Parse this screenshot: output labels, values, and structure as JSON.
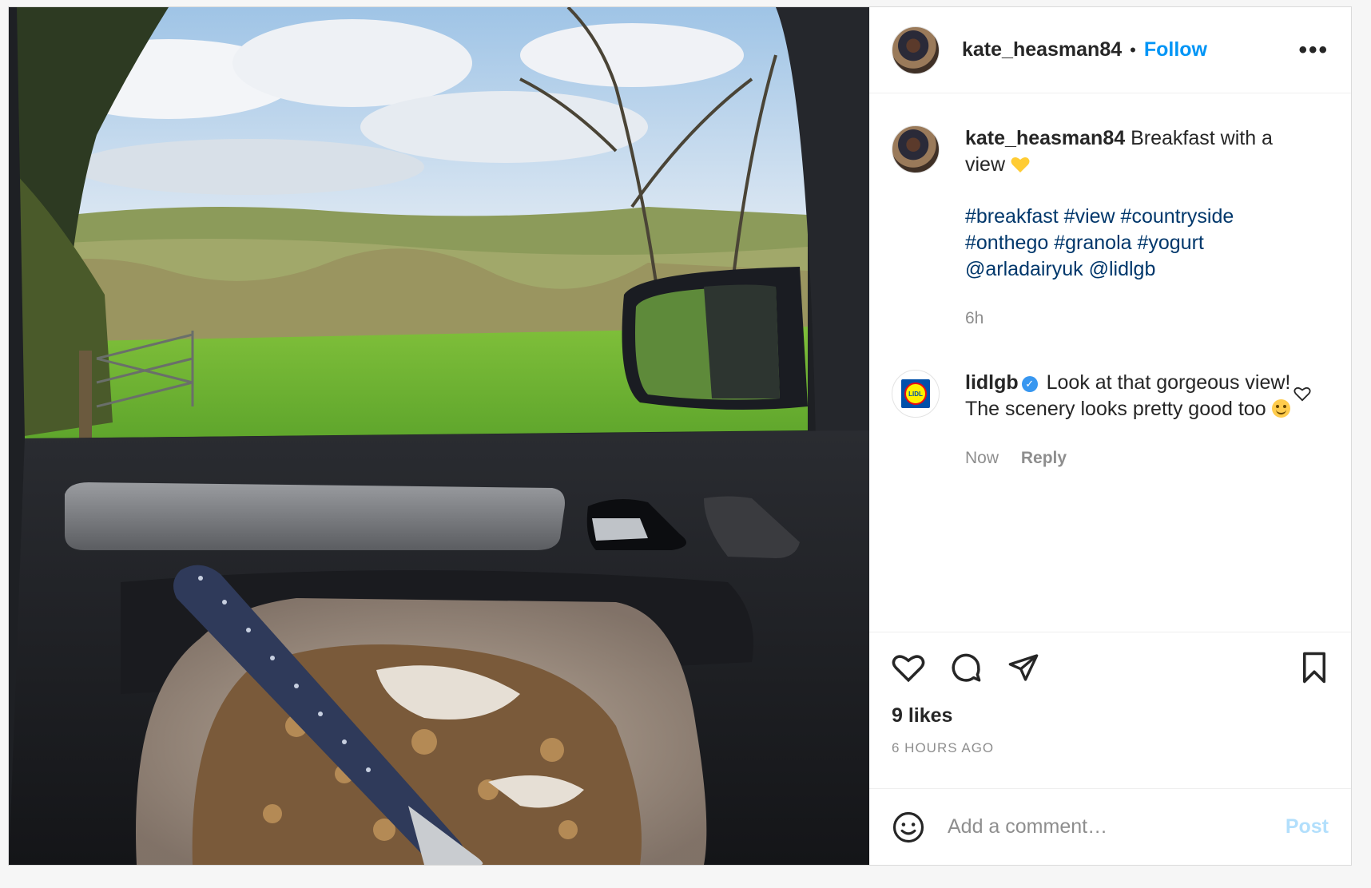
{
  "post": {
    "username": "kate_heasman84",
    "separator": "•",
    "follow_label": "Follow",
    "more_label": "•••"
  },
  "caption": {
    "username": "kate_heasman84",
    "text": "Breakfast with a view",
    "hashtags_line1": "#breakfast #view #countryside",
    "hashtags_line2": "#onthego #granola #yogurt",
    "mentions": "@arladairyuk @lidlgb",
    "time": "6h"
  },
  "comment": {
    "username": "lidlgb",
    "text": "Look at that gorgeous view! The scenery looks pretty good too",
    "time": "Now",
    "reply_label": "Reply",
    "logo_text": "LIDL"
  },
  "actions": {
    "likes": "9 likes",
    "time_ago": "6 HOURS AGO"
  },
  "add_comment": {
    "placeholder": "Add a comment…",
    "post_label": "Post"
  },
  "icons": {
    "like": "heart-icon",
    "comment": "comment-bubble-icon",
    "share": "paper-plane-icon",
    "save": "bookmark-icon",
    "emoji": "smiley-icon",
    "more": "more-dots-icon",
    "verified": "verified-badge-icon"
  },
  "colors": {
    "follow": "#0095f6",
    "hashtag": "#00376b",
    "muted": "#8e8e8e",
    "post_disabled": "#b2dffc"
  }
}
